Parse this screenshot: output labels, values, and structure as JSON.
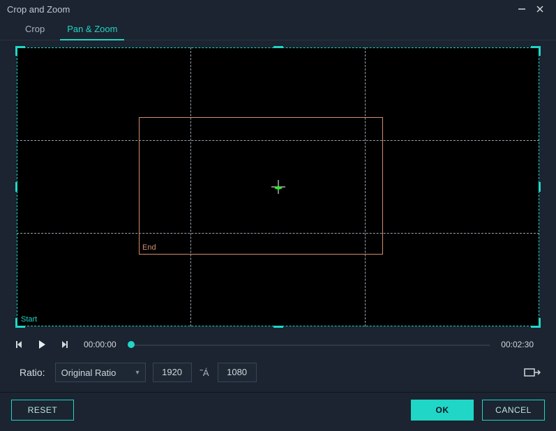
{
  "window": {
    "title": "Crop and Zoom"
  },
  "tabs": {
    "crop": "Crop",
    "pan_zoom": "Pan & Zoom",
    "active": "pan_zoom"
  },
  "frames": {
    "start_label": "Start",
    "end_label": "End"
  },
  "player": {
    "current_time": "00:00:00",
    "total_time": "00:02:30"
  },
  "ratio": {
    "label": "Ratio:",
    "selected": "Original Ratio",
    "width": "1920",
    "height": "1080",
    "separator": "˜Á"
  },
  "buttons": {
    "reset": "RESET",
    "ok": "OK",
    "cancel": "CANCEL"
  },
  "icons": {
    "minimize": "minimize",
    "close": "close",
    "prev_frame": "prev-frame",
    "play": "play",
    "next_frame": "next-frame",
    "chevron_down": "chevron-down",
    "swap": "swap"
  },
  "colors": {
    "accent": "#20d6c7",
    "end_frame": "#d28e6e",
    "bg": "#1b2430"
  }
}
